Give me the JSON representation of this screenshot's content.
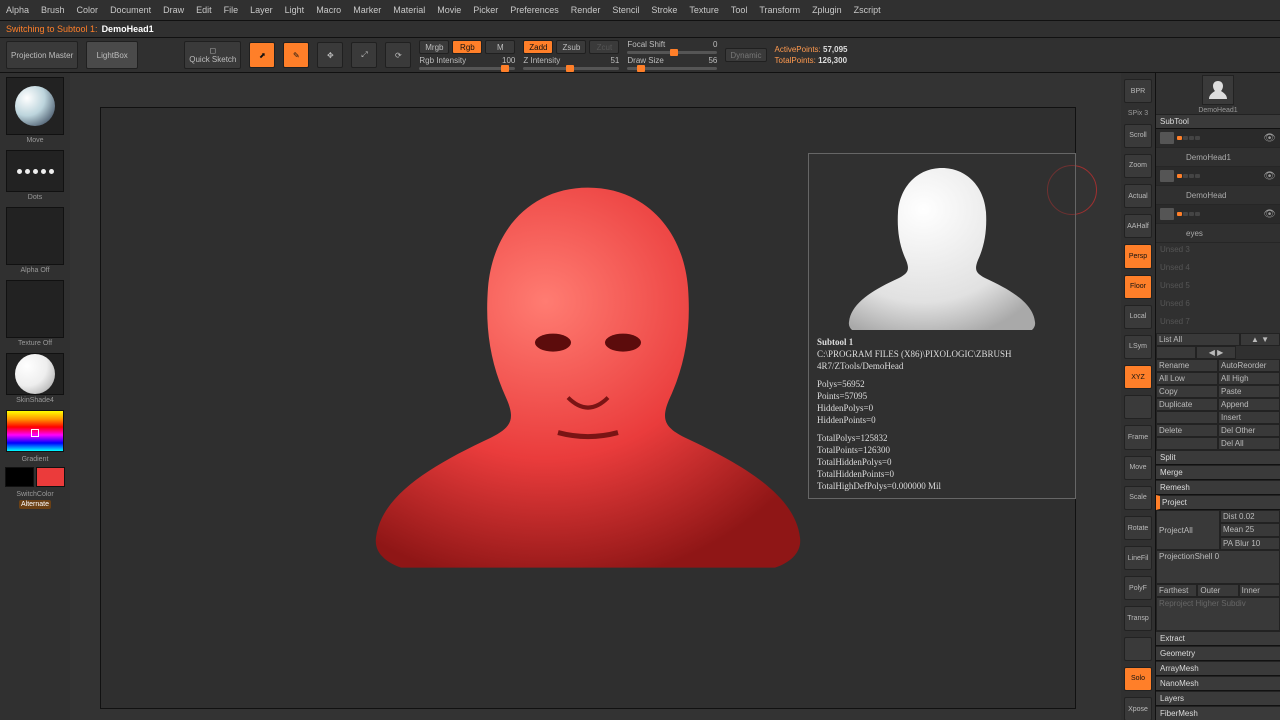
{
  "menu": [
    "Alpha",
    "Brush",
    "Color",
    "Document",
    "Draw",
    "Edit",
    "File",
    "Layer",
    "Light",
    "Macro",
    "Marker",
    "Material",
    "Movie",
    "Picker",
    "Preferences",
    "Render",
    "Stencil",
    "Stroke",
    "Texture",
    "Tool",
    "Transform",
    "Zplugin",
    "Zscript"
  ],
  "status": {
    "prefix": "Switching to Subtool 1:",
    "name": "DemoHead1"
  },
  "top": {
    "projMaster": "Projection Master",
    "lightBox": "LightBox",
    "quickSketch": "Quick Sketch",
    "edit": "Edit",
    "draw": "Draw",
    "move": "Move",
    "scale": "Scale",
    "rotate": "Rotate",
    "mrgb": "Mrgb",
    "rgb": "Rgb",
    "m": "M",
    "rgbInt": {
      "label": "Rgb Intensity",
      "val": "100"
    },
    "zadd": "Zadd",
    "zsub": "Zsub",
    "zcut": "Zcut",
    "zInt": {
      "label": "Z Intensity",
      "val": "51"
    },
    "focal": {
      "label": "Focal Shift",
      "val": "0"
    },
    "draws": {
      "label": "Draw Size",
      "val": "56"
    },
    "dynamic": "Dynamic",
    "active": {
      "label": "ActivePoints:",
      "val": "57,095"
    },
    "total": {
      "label": "TotalPoints:",
      "val": "126,300"
    }
  },
  "left": {
    "brush": "Move",
    "stroke": "Dots",
    "alpha": "Alpha Off",
    "texture": "Texture Off",
    "mat": "SkinShade4",
    "gradient": "Gradient",
    "switch": "SwitchColor",
    "alt": "Alternate"
  },
  "rside": [
    "BPR",
    "SPix 3",
    "Scroll",
    "Zoom",
    "Actual",
    "AAHalf",
    "Persp",
    "Floor",
    "Local",
    "LSym",
    "XYZ",
    "",
    "Frame",
    "Move",
    "Scale",
    "Rotate",
    "LineFil",
    "PolyF",
    "Transp",
    "",
    "Solo",
    "Xpose"
  ],
  "rsideOrange": [
    6,
    7,
    10,
    20
  ],
  "toolHdr": "DemoHead1",
  "subtool": {
    "title": "SubTool",
    "items": [
      {
        "name": "DemoHead1"
      },
      {
        "name": "DemoHead"
      },
      {
        "name": "eyes"
      }
    ],
    "slots": [
      "Unsed 3",
      "Unsed 4",
      "Unsed 5",
      "Unsed 6",
      "Unsed 7"
    ],
    "listAll": "List All",
    "ops": [
      [
        "Rename",
        "AutoReorder"
      ],
      [
        "All Low",
        "All High"
      ],
      [
        "Copy",
        "Paste"
      ],
      [
        "Duplicate",
        "Append"
      ],
      [
        "",
        "Insert"
      ],
      [
        "Delete",
        "Del Other"
      ],
      [
        "",
        "Del All"
      ]
    ],
    "sections": [
      "Split",
      "Merge",
      "Remesh"
    ],
    "project": "Project",
    "projAll": "ProjectAll",
    "dist": {
      "l": "Dist",
      "v": "0.02"
    },
    "mean": {
      "l": "Mean",
      "v": "25"
    },
    "pablur": {
      "l": "PA Blur",
      "v": "10"
    },
    "projShell": {
      "l": "ProjectionShell",
      "v": "0"
    },
    "far": [
      "Farthest",
      "Outer",
      "Inner"
    ],
    "reproj": "Reproject Higher Subdiv",
    "extract": "Extract",
    "tail": [
      "Geometry",
      "ArrayMesh",
      "NanoMesh",
      "Layers",
      "FiberMesh"
    ]
  },
  "info": {
    "title": "Subtool 1",
    "path": "C:\\PROGRAM FILES (X86)\\PIXOLOGIC\\ZBRUSH 4R7/ZTools/DemoHead",
    "polys": "Polys=56952",
    "points": "Points=57095",
    "hpoly": "HiddenPolys=0",
    "hpoint": "HiddenPoints=0",
    "tpolys": "TotalPolys=125832",
    "tpoints": "TotalPoints=126300",
    "thpoly": "TotalHiddenPolys=0",
    "thpoint": "TotalHiddenPoints=0",
    "thidef": "TotalHighDefPolys=0.000000 Mil"
  }
}
